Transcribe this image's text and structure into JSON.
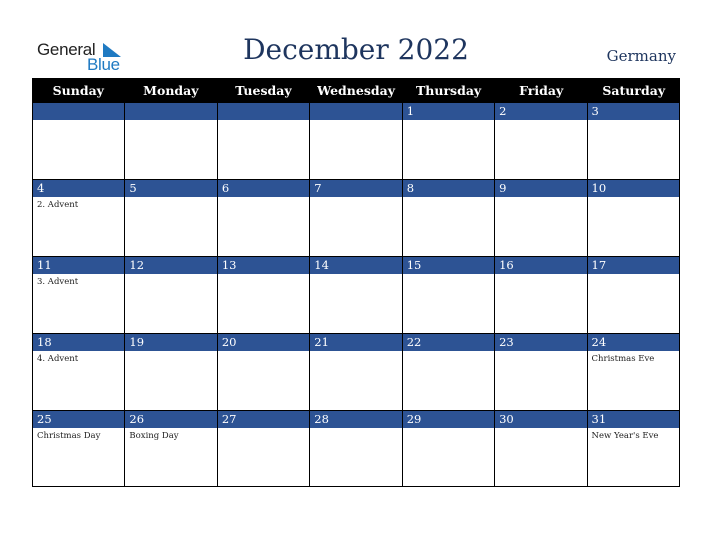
{
  "logo": {
    "general": "General",
    "blue": "Blue"
  },
  "title": "December 2022",
  "country": "Germany",
  "colors": {
    "header_bg": "#000000",
    "date_bar": "#2d5394",
    "title": "#1e355e",
    "logo_blue": "#1f7ac2"
  },
  "weekdays": [
    "Sunday",
    "Monday",
    "Tuesday",
    "Wednesday",
    "Thursday",
    "Friday",
    "Saturday"
  ],
  "weeks": [
    [
      {
        "day": "",
        "event": ""
      },
      {
        "day": "",
        "event": ""
      },
      {
        "day": "",
        "event": ""
      },
      {
        "day": "",
        "event": ""
      },
      {
        "day": "1",
        "event": ""
      },
      {
        "day": "2",
        "event": ""
      },
      {
        "day": "3",
        "event": ""
      }
    ],
    [
      {
        "day": "4",
        "event": "2. Advent"
      },
      {
        "day": "5",
        "event": ""
      },
      {
        "day": "6",
        "event": ""
      },
      {
        "day": "7",
        "event": ""
      },
      {
        "day": "8",
        "event": ""
      },
      {
        "day": "9",
        "event": ""
      },
      {
        "day": "10",
        "event": ""
      }
    ],
    [
      {
        "day": "11",
        "event": "3. Advent"
      },
      {
        "day": "12",
        "event": ""
      },
      {
        "day": "13",
        "event": ""
      },
      {
        "day": "14",
        "event": ""
      },
      {
        "day": "15",
        "event": ""
      },
      {
        "day": "16",
        "event": ""
      },
      {
        "day": "17",
        "event": ""
      }
    ],
    [
      {
        "day": "18",
        "event": "4. Advent"
      },
      {
        "day": "19",
        "event": ""
      },
      {
        "day": "20",
        "event": ""
      },
      {
        "day": "21",
        "event": ""
      },
      {
        "day": "22",
        "event": ""
      },
      {
        "day": "23",
        "event": ""
      },
      {
        "day": "24",
        "event": "Christmas Eve"
      }
    ],
    [
      {
        "day": "25",
        "event": "Christmas Day"
      },
      {
        "day": "26",
        "event": "Boxing Day"
      },
      {
        "day": "27",
        "event": ""
      },
      {
        "day": "28",
        "event": ""
      },
      {
        "day": "29",
        "event": ""
      },
      {
        "day": "30",
        "event": ""
      },
      {
        "day": "31",
        "event": "New Year's Eve"
      }
    ]
  ]
}
